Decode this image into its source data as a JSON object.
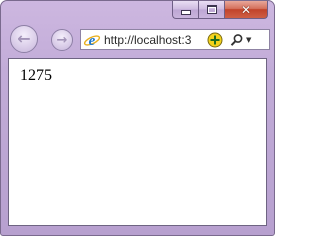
{
  "browser": {
    "address": {
      "url": "http://localhost:3"
    },
    "caption": {
      "minimize_icon": "minimize-icon",
      "maximize_icon": "maximize-icon",
      "close_icon": "close-icon",
      "close_glyph": "✕"
    },
    "nav": {
      "back_glyph": "←",
      "forward_glyph": "→"
    }
  },
  "page": {
    "content_text": "1275"
  }
}
